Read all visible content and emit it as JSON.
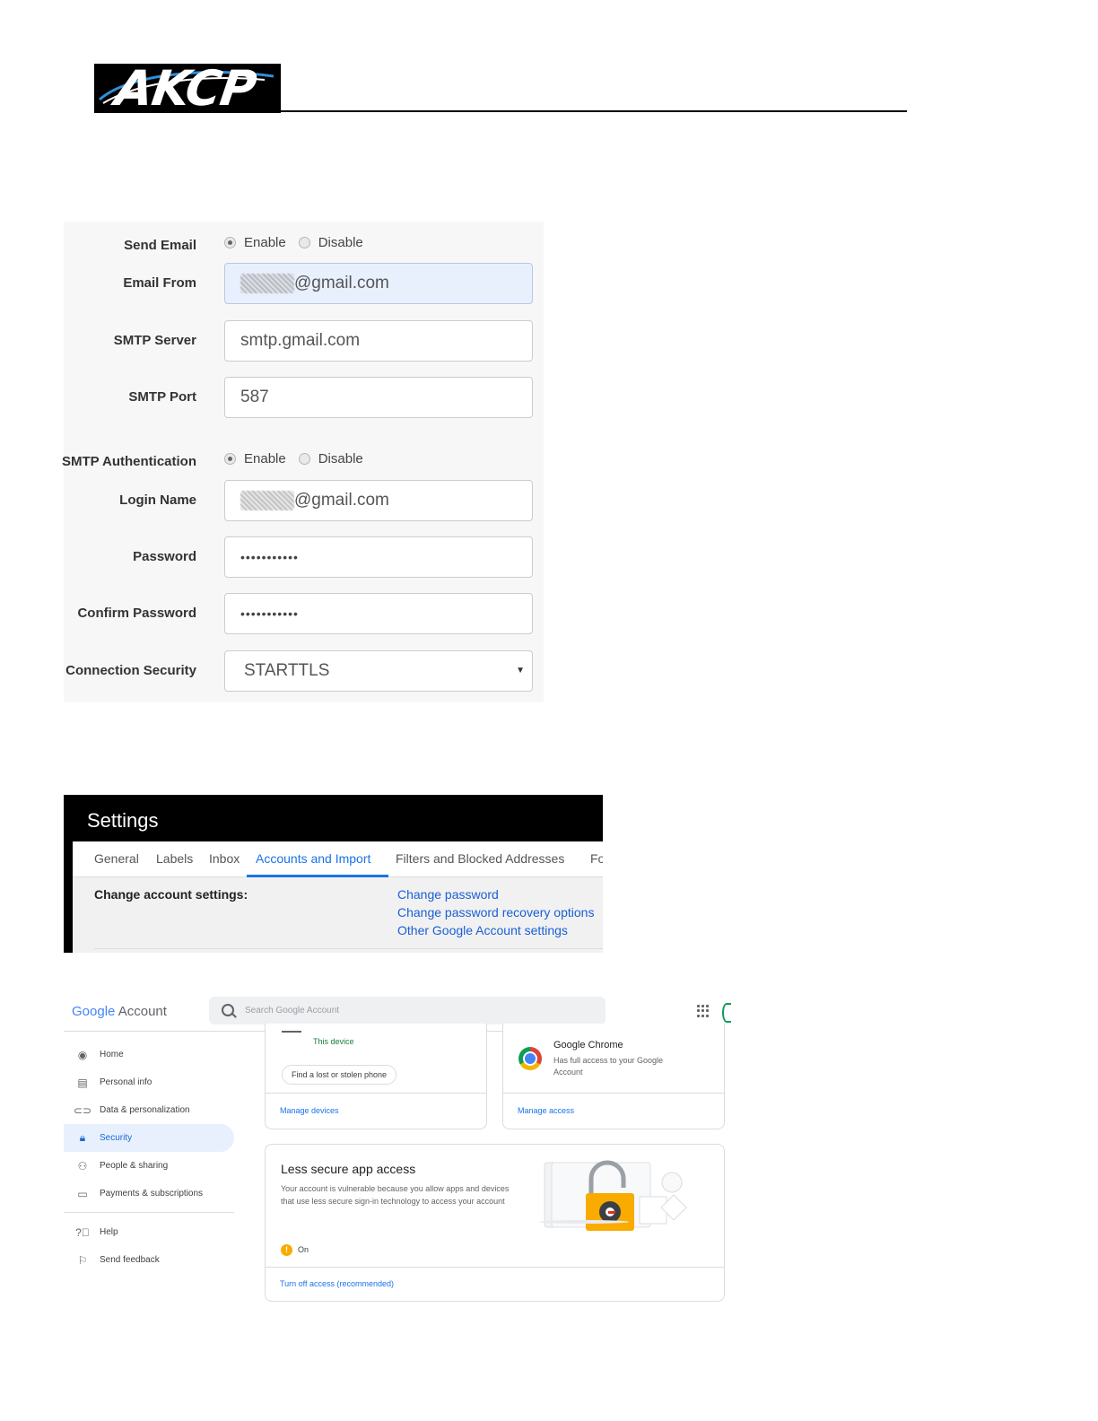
{
  "header": {
    "logo_text": "AKCP"
  },
  "email_form": {
    "send_email": {
      "label": "Send Email",
      "enable": "Enable",
      "disable": "Disable"
    },
    "email_from": {
      "label": "Email From",
      "value": "@gmail.com"
    },
    "smtp_server": {
      "label": "SMTP Server",
      "value": "smtp.gmail.com"
    },
    "smtp_port": {
      "label": "SMTP Port",
      "value": "587"
    },
    "smtp_auth": {
      "label": "SMTP Authentication",
      "enable": "Enable",
      "disable": "Disable"
    },
    "login_name": {
      "label": "Login Name",
      "value": "@gmail.com"
    },
    "password": {
      "label": "Password",
      "value": "•••••••••••"
    },
    "confirm_password": {
      "label": "Confirm Password",
      "value": "•••••••••••"
    },
    "connection_security": {
      "label": "Connection Security",
      "value": "STARTTLS"
    }
  },
  "gmail_settings": {
    "title": "Settings",
    "tabs": [
      "General",
      "Labels",
      "Inbox",
      "Accounts and Import",
      "Filters and Blocked Addresses",
      "Fo"
    ],
    "active_tab": "Accounts and Import",
    "section_label": "Change account settings:",
    "links": [
      "Change password",
      "Change password recovery options",
      "Other Google Account settings"
    ]
  },
  "google_account": {
    "brand": {
      "google": "Google",
      "account": "Account"
    },
    "search_placeholder": "Search Google Account",
    "nav": [
      {
        "label": "Home",
        "icon": "home-icon"
      },
      {
        "label": "Personal info",
        "icon": "id-card-icon"
      },
      {
        "label": "Data & personalization",
        "icon": "toggle-icon"
      },
      {
        "label": "Security",
        "icon": "lock-icon"
      },
      {
        "label": "People & sharing",
        "icon": "people-icon"
      },
      {
        "label": "Payments & subscriptions",
        "icon": "card-icon"
      }
    ],
    "nav_bottom": [
      {
        "label": "Help",
        "icon": "help-icon"
      },
      {
        "label": "Send feedback",
        "icon": "feedback-icon"
      }
    ],
    "active_nav": "Security",
    "devices_card": {
      "this_device": "This device",
      "find_phone": "Find a lost or stolen phone",
      "manage_devices": "Manage devices"
    },
    "chrome_card": {
      "title": "Google Chrome",
      "desc": "Has full access to your Google Account",
      "manage_access": "Manage access"
    },
    "less_secure_card": {
      "title": "Less secure app access",
      "desc": "Your account is vulnerable because you allow apps and devices that use less secure sign-in technology to access your account",
      "status": "On",
      "action": "Turn off access (recommended)"
    },
    "colors": {
      "accent": "#1a73e8",
      "warning": "#f9ab00"
    }
  }
}
